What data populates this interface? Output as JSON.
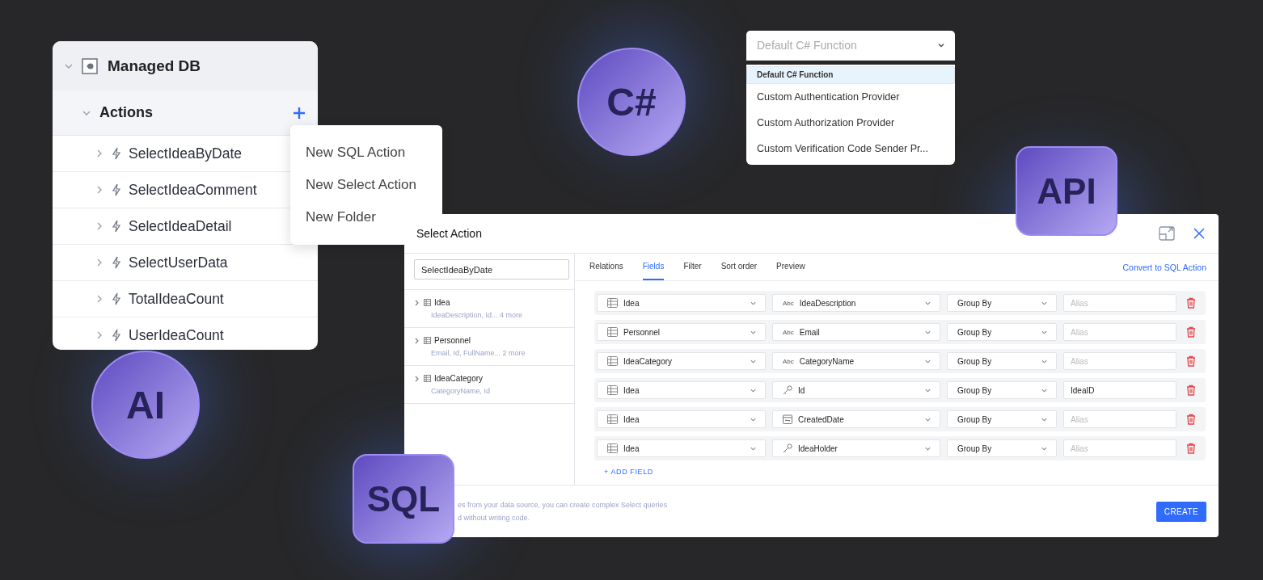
{
  "tree": {
    "label": "Managed DB",
    "expanded": true,
    "children": [
      {
        "label": "Actions",
        "expanded": true,
        "children": [
          {
            "label": "SelectIdeaByDate",
            "expanded": false
          },
          {
            "label": "SelectIdeaComment",
            "expanded": false
          },
          {
            "label": "SelectIdeaDetail",
            "expanded": false
          },
          {
            "label": "SelectUserData",
            "expanded": false
          },
          {
            "label": "TotalIdeaCount",
            "expanded": false
          },
          {
            "label": "UserIdeaCount",
            "expanded": false
          }
        ]
      }
    ]
  },
  "context_menu": [
    "New SQL Action",
    "New Select Action",
    "New Folder"
  ],
  "function_select": {
    "value": "Default C# Function",
    "options": [
      {
        "label": "Default C# Function",
        "selected": true
      },
      {
        "label": "Custom Authentication Provider",
        "selected": false
      },
      {
        "label": "Custom Authorization Provider",
        "selected": false
      },
      {
        "label": "Custom Verification Code Sender Pr...",
        "selected": false
      }
    ]
  },
  "badges": [
    {
      "text": "C#",
      "kind": "circle"
    },
    {
      "text": "API",
      "kind": "square"
    },
    {
      "text": "AI",
      "kind": "circle"
    },
    {
      "text": "SQL",
      "kind": "square"
    }
  ],
  "dialog": {
    "title": "Select Action",
    "name_value": "SelectIdeaByDate",
    "entities": [
      {
        "name": "Idea",
        "fields": "IdeaDescription, Id... 4 more"
      },
      {
        "name": "Personnel",
        "fields": "Email, Id, FullName... 2 more"
      },
      {
        "name": "IdeaCategory",
        "fields": "CategoryName, Id"
      }
    ],
    "tabs": [
      {
        "label": "Relations",
        "selected": false
      },
      {
        "label": "Fields",
        "selected": true
      },
      {
        "label": "Filter",
        "selected": false
      },
      {
        "label": "Sort order",
        "selected": false
      },
      {
        "label": "Preview",
        "selected": false
      }
    ],
    "convert_link": "Convert to SQL Action",
    "rows": [
      {
        "table": "Idea",
        "kind": "text",
        "icon_text": "Abc",
        "field": "IdeaDescription",
        "aggregate": "Group By",
        "alias_placeholder": "Alias"
      },
      {
        "table": "Personnel",
        "kind": "text",
        "icon_text": "Abc",
        "field": "Email",
        "aggregate": "Group By",
        "alias_placeholder": "Alias"
      },
      {
        "table": "IdeaCategory",
        "kind": "text",
        "icon_text": "Abc",
        "field": "CategoryName",
        "aggregate": "Group By",
        "alias_placeholder": "Alias"
      },
      {
        "table": "Idea",
        "kind": "key",
        "field": "Id",
        "aggregate": "Group By",
        "alias": "IdeaID"
      },
      {
        "table": "Idea",
        "kind": "date",
        "field": "CreatedDate",
        "aggregate": "Group By",
        "alias_placeholder": "Alias"
      },
      {
        "table": "Idea",
        "kind": "key",
        "field": "IdeaHolder",
        "aggregate": "Group By",
        "alias_placeholder": "Alias"
      }
    ],
    "add_field": "+ ADD FIELD",
    "footer_lines": [
      "es from your data source, you can create complex Select queries",
      "d without writing code."
    ],
    "create_button": "CREATE"
  }
}
